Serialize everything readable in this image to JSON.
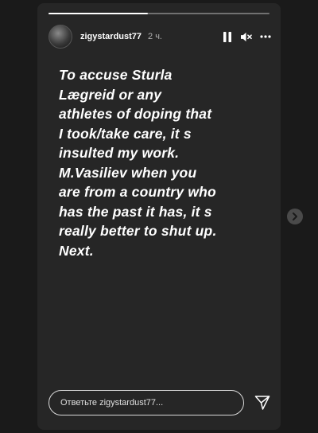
{
  "story": {
    "progress": 0.45,
    "header": {
      "username": "zigystardust77",
      "time": "2 ч."
    },
    "text": "To accuse Sturla\nLægreid or any\nathletes of doping that\nI took/take care, it s\ninsulted my work.\nM.Vasiliev when you\nare from a country who\nhas the past it has, it s\nreally better to shut up.\nNext.",
    "reply": {
      "placeholder": "Ответьте zigystardust77..."
    }
  },
  "icons": {
    "pause": "pause-icon",
    "mute": "mute-icon",
    "more": "more-icon",
    "send": "send-icon",
    "next": "chevron-right-icon"
  },
  "colors": {
    "background": "#1a1a1a",
    "story_background": "#262626",
    "text": "#ffffff"
  }
}
